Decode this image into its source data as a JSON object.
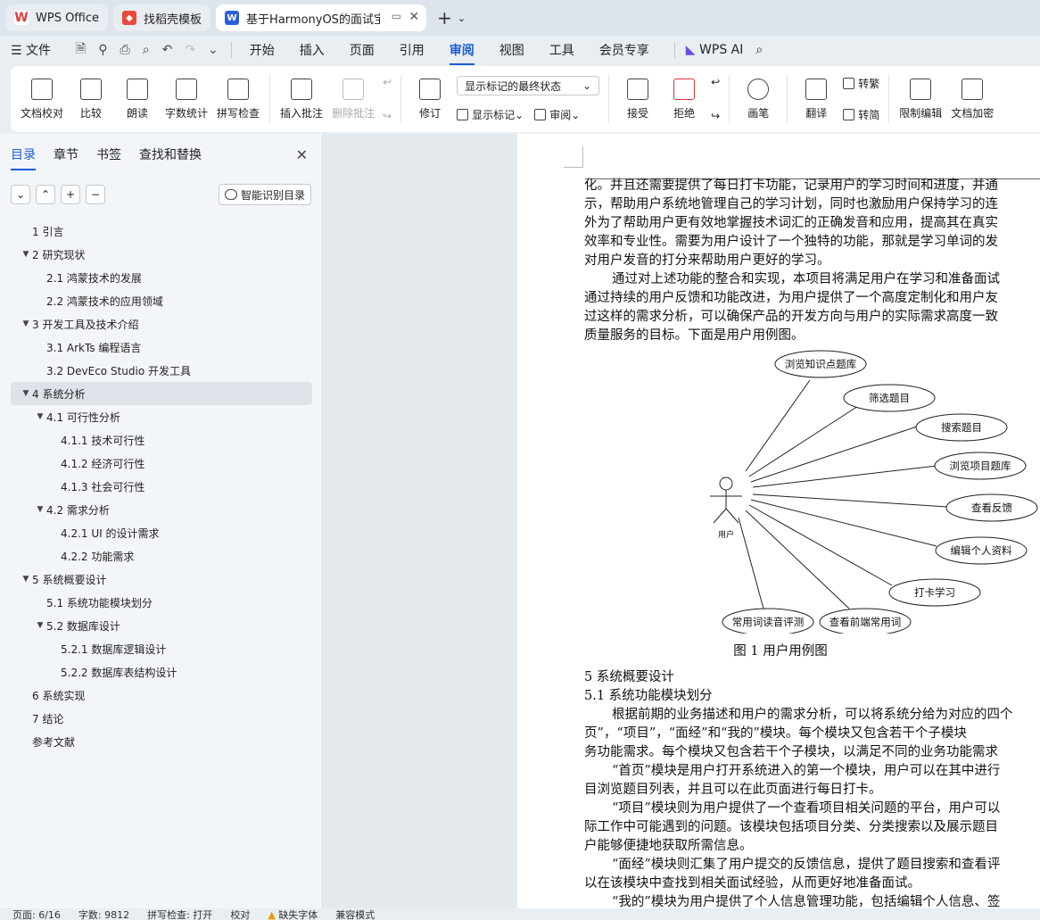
{
  "tabs": [
    {
      "label": "WPS Office",
      "icon": "wps-logo-icon",
      "color": "#e03a3a"
    },
    {
      "label": "找稻壳模板",
      "icon": "docer-logo-icon",
      "color": "#e84a3c"
    },
    {
      "label": "基于HarmonyOS的面试宝典a",
      "icon": "word-doc-icon",
      "color": "#2b5fd9"
    }
  ],
  "menu": {
    "file": "文件",
    "items": [
      "开始",
      "插入",
      "页面",
      "引用",
      "审阅",
      "视图",
      "工具",
      "会员专享"
    ],
    "active": "审阅",
    "ai": "WPS AI"
  },
  "ribbon": {
    "proof": "文档校对",
    "compare": "比较",
    "read": "朗读",
    "wordcount": "字数统计",
    "spell": "拼写检查",
    "insert_comment": "插入批注",
    "delete_comment": "删除批注",
    "revise": "修订",
    "markup_select": "显示标记的最终状态",
    "show_markup": "显示标记",
    "review": "审阅",
    "accept": "接受",
    "reject": "拒绝",
    "pen": "画笔",
    "translate": "翻译",
    "to_trad": "转繁",
    "to_simp": "转简",
    "restrict": "限制编辑",
    "encrypt": "文档加密"
  },
  "nav": {
    "tabs": [
      "目录",
      "章节",
      "书签",
      "查找和替换"
    ],
    "smart_btn": "智能识别目录",
    "toc": [
      {
        "label": "1  引言",
        "level": 1,
        "arrow": ""
      },
      {
        "label": "2  研究现状",
        "level": 1,
        "arrow": "▼"
      },
      {
        "label": "2.1  鸿蒙技术的发展",
        "level": 2,
        "arrow": ""
      },
      {
        "label": "2.2 鸿蒙技术的应用领域",
        "level": 2,
        "arrow": ""
      },
      {
        "label": "3  开发工具及技术介绍",
        "level": 1,
        "arrow": "▼"
      },
      {
        "label": "3.1 ArkTs 编程语言",
        "level": 2,
        "arrow": ""
      },
      {
        "label": "3.2 DevEco Studio 开发工具",
        "level": 2,
        "arrow": ""
      },
      {
        "label": "4  系统分析",
        "level": 1,
        "arrow": "▼",
        "selected": true
      },
      {
        "label": "4.1  可行性分析",
        "level": 2,
        "arrow": "▼"
      },
      {
        "label": "4.1.1  技术可行性",
        "level": 3,
        "arrow": ""
      },
      {
        "label": "4.1.2  经济可行性",
        "level": 3,
        "arrow": ""
      },
      {
        "label": "4.1.3  社会可行性",
        "level": 3,
        "arrow": ""
      },
      {
        "label": "4.2  需求分析",
        "level": 2,
        "arrow": "▼"
      },
      {
        "label": "4.2.1 UI 的设计需求",
        "level": 3,
        "arrow": ""
      },
      {
        "label": "4.2.2  功能需求",
        "level": 3,
        "arrow": ""
      },
      {
        "label": "5  系统概要设计",
        "level": 1,
        "arrow": "▼"
      },
      {
        "label": "5.1  系统功能模块划分",
        "level": 2,
        "arrow": ""
      },
      {
        "label": "5.2 数据库设计",
        "level": 2,
        "arrow": "▼"
      },
      {
        "label": "5.2.1 数据库逻辑设计",
        "level": 3,
        "arrow": ""
      },
      {
        "label": "5.2.2  数据库表结构设计",
        "level": 3,
        "arrow": ""
      },
      {
        "label": "6  系统实现",
        "level": 1,
        "arrow": ""
      },
      {
        "label": "7  结论",
        "level": 1,
        "arrow": ""
      },
      {
        "label": "参考文献",
        "level": 1,
        "arrow": ""
      }
    ]
  },
  "doc": {
    "lines_top": [
      "化。并且还需要提供了每日打卡功能，记录用户的学习时间和进度，并通",
      "示，帮助用户系统地管理自己的学习计划，同时也激励用户保持学习的连",
      "外为了帮助用户更有效地掌握技术词汇的正确发音和应用，提高其在真实",
      "效率和专业性。需要为用户设计了一个独特的功能，那就是学习单词的发",
      "对用户发音的打分来帮助用户更好的学习。"
    ],
    "para2": [
      "通过对上述功能的整合和实现，本项目将满足用户在学习和准备面试",
      "通过持续的用户反馈和功能改进，为用户提供了一个高度定制化和用户友",
      "过这样的需求分析，可以确保产品的开发方向与用户的实际需求高度一致",
      "质量服务的目标。下面是用户用例图。"
    ],
    "actor": "用户",
    "usecases": [
      "浏览知识点题库",
      "筛选题目",
      "搜索题目",
      "浏览项目题库",
      "查看反馈",
      "编辑个人资料",
      "打卡学习",
      "查看前端常用词",
      "常用词读音评测"
    ],
    "caption": "图 1  用户用例图",
    "h1": "5  系统概要设计",
    "h2": "5.1  系统功能模块划分",
    "para3": [
      "根据前期的业务描述和用户的需求分析，可以将系统分给为对应的四个",
      "页”，“项目”，“面经”和“我的”模块。每个模块又包含若干个子模块",
      "务功能需求。每个模块又包含若干个子模块，以满足不同的业务功能需求"
    ],
    "para4": [
      "“首页”模块是用户打开系统进入的第一个模块，用户可以在其中进行",
      "目浏览题目列表，并且可以在此页面进行每日打卡。"
    ],
    "para5": [
      "“项目”模块则为用户提供了一个查看项目相关问题的平台，用户可以",
      "际工作中可能遇到的问题。该模块包括项目分类、分类搜索以及展示题目",
      "户能够便捷地获取所需信息。"
    ],
    "para6": [
      "“面经”模块则汇集了用户提交的反馈信息，提供了题目搜索和查看评",
      "以在该模块中查找到相关面试经验，从而更好地准备面试。"
    ],
    "para7": [
      "“我的”模块为用户提供了个人信息管理功能，包括编辑个人信息、签"
    ]
  },
  "status": {
    "page": "页面: 6/16",
    "words": "字数: 9812",
    "spell": "拼写检查: 打开",
    "proof": "校对",
    "missing_font": "缺失字体",
    "compat": "兼容模式"
  }
}
